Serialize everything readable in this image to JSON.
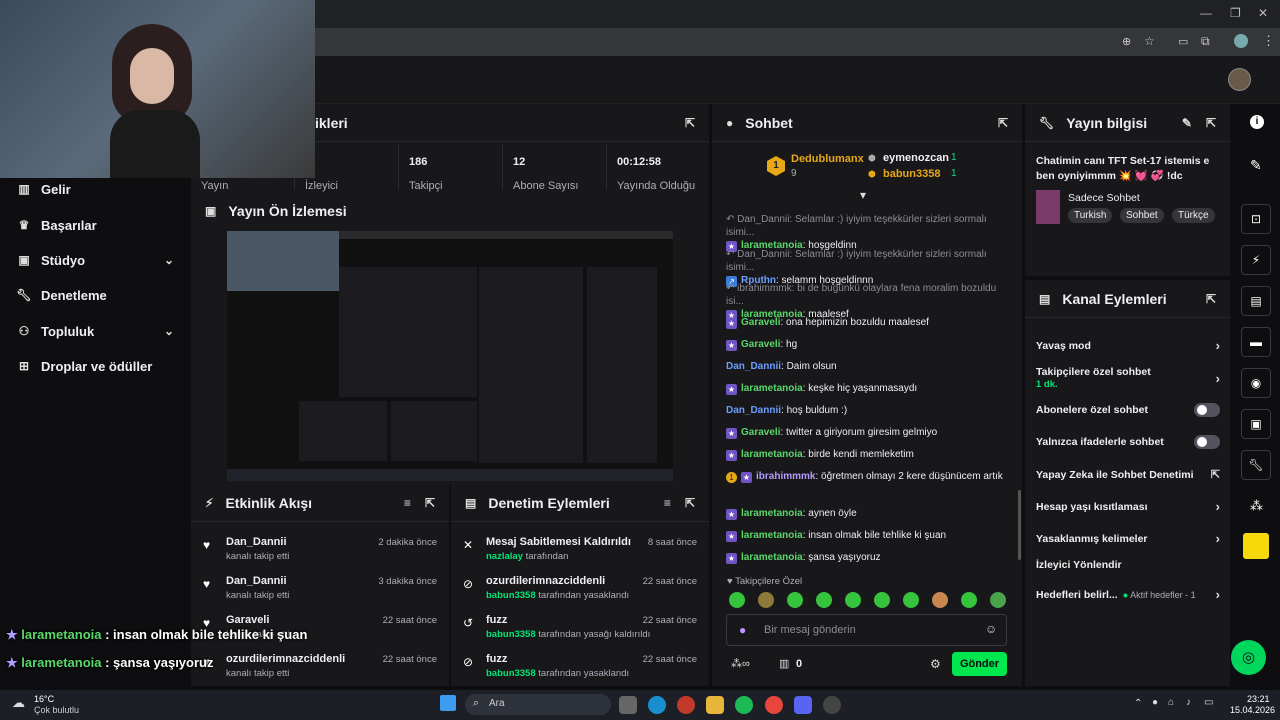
{
  "sidebar": {
    "items": [
      {
        "label": "Gelir",
        "icon": "bar-chart-icon"
      },
      {
        "label": "Başarılar",
        "icon": "trophy-icon"
      },
      {
        "label": "Stüdyo",
        "icon": "studio-icon"
      },
      {
        "label": "Denetleme",
        "icon": "wrench-icon"
      },
      {
        "label": "Topluluk",
        "icon": "community-icon"
      },
      {
        "label": "Droplar ve ödüller",
        "icon": "gift-icon"
      }
    ]
  },
  "stats": {
    "title": "ikleri",
    "items": [
      {
        "value": "",
        "label": "Yayın"
      },
      {
        "value": "",
        "label": "İzleyici"
      },
      {
        "value": "186",
        "label": "Takipçi"
      },
      {
        "value": "12",
        "label": "Abone Sayısı"
      },
      {
        "value": "00:12:58",
        "label": "Yayında Olduğu"
      }
    ]
  },
  "preview": {
    "title": "Yayın Ön İzlemesi"
  },
  "activity": {
    "title": "Etkinlik Akışı",
    "rows": [
      {
        "name": "Dan_Dannii",
        "sub": "kanalı takip etti",
        "time": "2 dakika önce"
      },
      {
        "name": "Dan_Dannii",
        "sub": "kanalı takip etti",
        "time": "3 dakika önce"
      },
      {
        "name": "Garaveli",
        "sub": "kanalı takip etti",
        "time": "22 saat önce"
      },
      {
        "name": "ozurdilerimnazciddenli",
        "sub": "kanalı takip etti",
        "time": "22 saat önce"
      }
    ]
  },
  "modactions": {
    "title": "Denetim Eylemleri",
    "rows": [
      {
        "name": "Mesaj Sabitlemesi Kaldırıldı",
        "by": "nazlalay",
        "sub": "tarafından",
        "time": "8 saat önce"
      },
      {
        "name": "ozurdilerimnazciddenli",
        "by": "babun3358",
        "sub": "tarafından yasaklandı",
        "time": "22 saat önce"
      },
      {
        "name": "fuzz",
        "by": "babun3358",
        "sub": "tarafından yasağı kaldırıldı",
        "time": "22 saat önce"
      },
      {
        "name": "fuzz",
        "by": "babun3358",
        "sub": "tarafından yasaklandı",
        "time": "22 saat önce"
      }
    ]
  },
  "chat": {
    "title": "Sohbet",
    "top_gifter": {
      "rank": "1",
      "name": "Dedublumanx",
      "count": "9"
    },
    "gifters": [
      {
        "name": "eymenozcan",
        "count": "1"
      },
      {
        "name": "babun3358",
        "count": "1"
      }
    ],
    "messages": [
      {
        "reply": "↶ Dan_Dannii: Selamlar :) iyiyim teşekkürler sizleri sormalı isimi...",
        "user": "larametanoia",
        "text": ": hoşgeldinn",
        "color": "green"
      },
      {
        "reply": "↶ Dan_Dannii: Selamlar :) iyiyim teşekkürler sizleri sormalı isimi...",
        "user": "Rputhn",
        "text": ": selamm hoşgeldinnn",
        "color": "blue"
      },
      {
        "reply": "↶ ibrahimmmk: bi de bugünkü olaylara fena moralim bozuldu isi...",
        "user": "larametanoia",
        "text": ": maalesef",
        "color": "green"
      },
      {
        "reply": "",
        "user": "Garaveli",
        "text": ": ona hepimizin bozuldu maalesef",
        "color": "green"
      },
      {
        "reply": "",
        "user": "Garaveli",
        "text": ": hg",
        "color": "green"
      },
      {
        "reply": "",
        "user": "Dan_Dannii",
        "text": ": Daim olsun",
        "color": "blue"
      },
      {
        "reply": "",
        "user": "larametanoia",
        "text": ": keşke hiç yaşanmasaydı",
        "color": "green"
      },
      {
        "reply": "",
        "user": "Dan_Dannii",
        "text": ": hoş buldum :)",
        "color": "blue"
      },
      {
        "reply": "",
        "user": "Garaveli",
        "text": ": twitter a giriyorum giresim gelmiyo",
        "color": "green"
      },
      {
        "reply": "",
        "user": "larametanoia",
        "text": ": birde kendi memleketim",
        "color": "green"
      },
      {
        "reply": "",
        "user": "ibrahimmmk",
        "text": ": öğretmen olmayı 2 kere düşünücem artık",
        "color": "purple"
      },
      {
        "reply": "",
        "user": "larametanoia",
        "text": ": aynen öyle",
        "color": "green"
      },
      {
        "reply": "",
        "user": "larametanoia",
        "text": ": insan olmak bile tehlike ki şuan",
        "color": "green"
      },
      {
        "reply": "",
        "user": "larametanoia",
        "text": ": şansa yaşıyoruz",
        "color": "green"
      }
    ],
    "followers_only": "Takipçilere Özel",
    "input_placeholder": "Bir mesaj gönderin",
    "points": "0",
    "send_label": "Gönder"
  },
  "stream_info": {
    "title": "Yayın bilgisi",
    "stream_title": "Chatimin canı TFT Set-17 istemis e ben oyniyimmm 💥 💓 💞 !dc",
    "category": "Sadece Sohbet",
    "tags": [
      "Turkish",
      "Sohbet",
      "Türkçe"
    ]
  },
  "channel_actions": {
    "title": "Kanal Eylemleri",
    "rows": [
      {
        "label": "Yavaş mod",
        "kind": "chevron"
      },
      {
        "label": "Takipçilere özel sohbet",
        "sub": "1 dk.",
        "kind": "chevron"
      },
      {
        "label": "Abonelere özel sohbet",
        "kind": "toggle"
      },
      {
        "label": "Yalnızca ifadelerle sohbet",
        "kind": "toggle"
      },
      {
        "label": "Yapay Zeka ile Sohbet Denetimi",
        "kind": "external"
      },
      {
        "label": "Hesap yaşı kısıtlaması",
        "kind": "chevron"
      },
      {
        "label": "Yasaklanmış kelimeler",
        "kind": "chevron"
      },
      {
        "label": "İzleyici Yönlendir",
        "kind": "none"
      },
      {
        "label": "Hedefleri belirl...",
        "sub": "Aktif hedefler - 1",
        "kind": "chevron"
      }
    ]
  },
  "overlay": {
    "lines": [
      {
        "user": "larametanoia",
        "text": " : insan olmak bile tehlike ki şuan"
      },
      {
        "user": "larametanoia",
        "text": " : şansa yaşıyoruz"
      }
    ]
  },
  "taskbar": {
    "weather_temp": "16°C",
    "weather_desc": "Çok bulutlu",
    "search_placeholder": "Ara",
    "time": "23:21",
    "date": "15.04.2026"
  },
  "colors": {
    "accent": "#00e676",
    "brand": "#9147ff",
    "bg": "#0e0e10",
    "panel": "#18181b"
  }
}
